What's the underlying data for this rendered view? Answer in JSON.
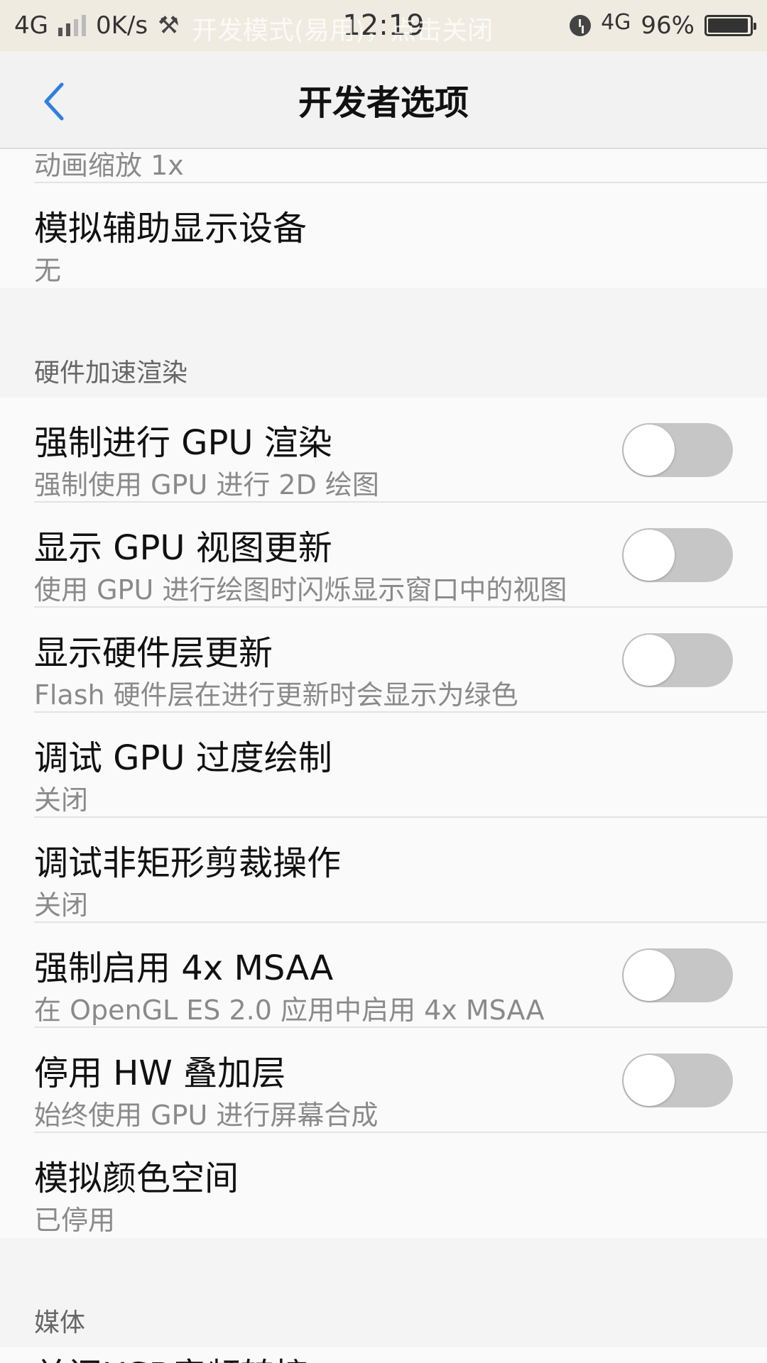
{
  "status_bar": {
    "network_left": "4G",
    "speed": "0K/s",
    "notice": "开发模式(易用)，点击关闭",
    "time": "12:19",
    "network_right": "4G",
    "battery_percent": "96%",
    "battery_level": 0.96
  },
  "header": {
    "title": "开发者选项",
    "back_icon": "chevron-left-icon",
    "accent_color": "#2f7fe0"
  },
  "top_partial_subtitle": "动画缩放 1x",
  "section_top": {
    "items": [
      {
        "title": "模拟辅助显示设备",
        "subtitle": "无"
      }
    ]
  },
  "section_hw": {
    "header": "硬件加速渲染",
    "items": [
      {
        "title": "强制进行 GPU 渲染",
        "subtitle": "强制使用 GPU 进行 2D 绘图",
        "toggle": false
      },
      {
        "title": "显示 GPU 视图更新",
        "subtitle": "使用 GPU 进行绘图时闪烁显示窗口中的视图",
        "toggle": false
      },
      {
        "title": "显示硬件层更新",
        "subtitle": "Flash 硬件层在进行更新时会显示为绿色",
        "toggle": false
      },
      {
        "title": "调试 GPU 过度绘制",
        "subtitle": "关闭"
      },
      {
        "title": "调试非矩形剪裁操作",
        "subtitle": "关闭"
      },
      {
        "title": "强制启用 4x MSAA",
        "subtitle": "在 OpenGL ES 2.0 应用中启用 4x MSAA",
        "toggle": false
      },
      {
        "title": "停用 HW 叠加层",
        "subtitle": "始终使用 GPU 进行屏幕合成",
        "toggle": false
      },
      {
        "title": "模拟颜色空间",
        "subtitle": "已停用"
      }
    ]
  },
  "section_media": {
    "header": "媒体",
    "peek_title": "关闭USB音频转接"
  }
}
